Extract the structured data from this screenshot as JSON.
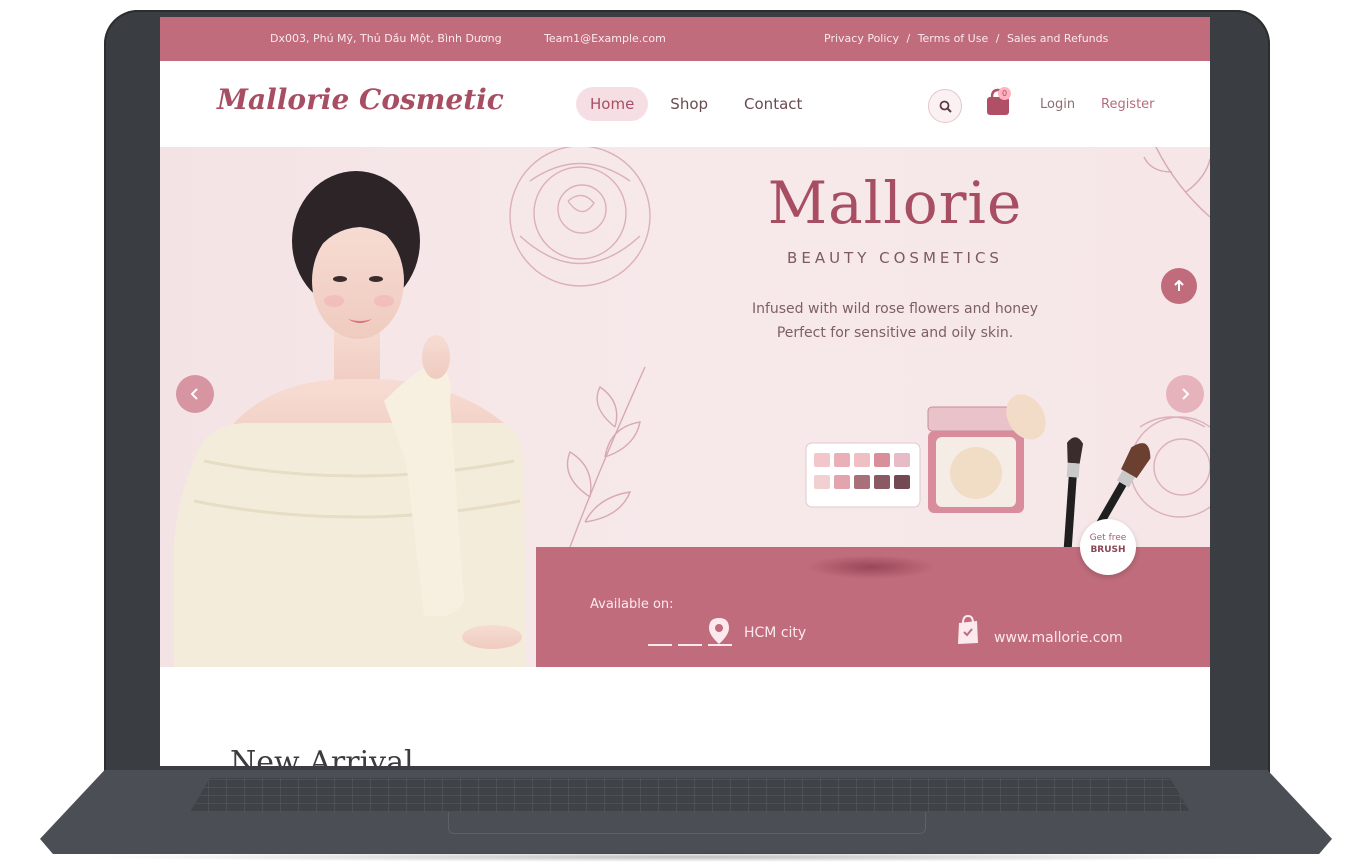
{
  "topbar": {
    "address": "Dx003, Phú Mỹ, Thủ Dầu Một, Bình Dương",
    "email": "Team1@Example.com",
    "links": [
      "Privacy Policy",
      "Terms of Use",
      "Sales and Refunds"
    ],
    "separator": "/"
  },
  "header": {
    "logo": "Mallorie Cosmetic",
    "nav": [
      "Home",
      "Shop",
      "Contact"
    ],
    "active_nav": "Home",
    "cart_count": "0",
    "login": "Login",
    "register": "Register"
  },
  "hero": {
    "title": "Mallorie",
    "subtitle": "BEAUTY COSMETICS",
    "description_line1": "Infused with wild rose flowers and honey",
    "description_line2": "Perfect for sensitive and oily skin.",
    "available_label": "Available on:",
    "city": "HCM city",
    "website": "www.mallorie.com",
    "badge_line1": "Get free",
    "badge_line2": "BRUSH"
  },
  "section": {
    "title": "New Arrival"
  },
  "colors": {
    "brand": "#c06c7c",
    "logo": "#a84e63",
    "hero_bg": "#f6e6e8",
    "laptop": "#3a3d42"
  },
  "icons": [
    "search-icon",
    "shopping-bag-icon",
    "chevron-left-icon",
    "chevron-right-icon",
    "arrow-up-icon",
    "location-pin-icon",
    "shopping-bag-icon"
  ]
}
